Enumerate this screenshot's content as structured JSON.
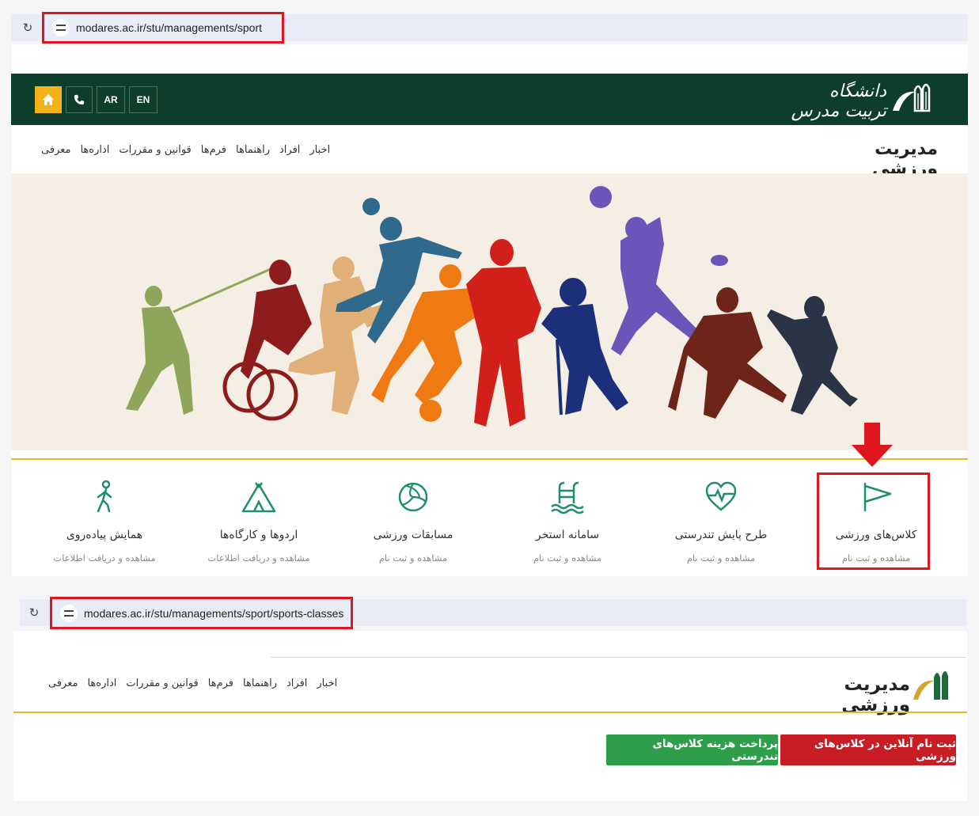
{
  "screenshot1": {
    "url": "modares.ac.ir/stu/managements/sport",
    "lang_buttons": [
      "EN",
      "AR"
    ],
    "logo_text": "دانشگاه تربیت مدرس",
    "site_title": "مدیریت ورزشی",
    "nav": [
      "معرفی",
      "اداره‌ها",
      "قوانین و مقررات",
      "فرم‌ها",
      "راهنماها",
      "افراد",
      "اخبار"
    ],
    "services": [
      {
        "title": "کلاس‌های ورزشی",
        "sub": "مشاهده و ثبت نام",
        "icon": "flag-icon"
      },
      {
        "title": "طرح پایش تندرستی",
        "sub": "مشاهده و ثبت نام",
        "icon": "heart-pulse-icon"
      },
      {
        "title": "سامانه استخر",
        "sub": "مشاهده و ثبت نام",
        "icon": "pool-icon"
      },
      {
        "title": "مسابقات ورزشی",
        "sub": "مشاهده و ثبت نام",
        "icon": "volleyball-icon"
      },
      {
        "title": "اردوها و کارگاه‌ها",
        "sub": "مشاهده و دریافت اطلاعات",
        "icon": "tent-icon"
      },
      {
        "title": "همایش پیاده‌روی",
        "sub": "مشاهده و دریافت اطلاعات",
        "icon": "walking-icon"
      }
    ]
  },
  "screenshot2": {
    "url": "modares.ac.ir/stu/managements/sport/sports-classes",
    "site_title": "مدیریت ورزشی",
    "nav": [
      "معرفی",
      "اداره‌ها",
      "قوانین و مقررات",
      "فرم‌ها",
      "راهنماها",
      "افراد",
      "اخبار"
    ],
    "register_button": "ثبت نام آنلاین در کلاس‌های ورزشی",
    "payment_button": "پرداخت هزینه کلاس‌های تندرستی"
  },
  "colors": {
    "header_green": "#0d3d2b",
    "accent_yellow": "#f2b218",
    "highlight_red": "#e0161e",
    "icon_teal": "#1f8f6a",
    "button_red": "#c81d25",
    "button_green": "#2e9e4a"
  }
}
